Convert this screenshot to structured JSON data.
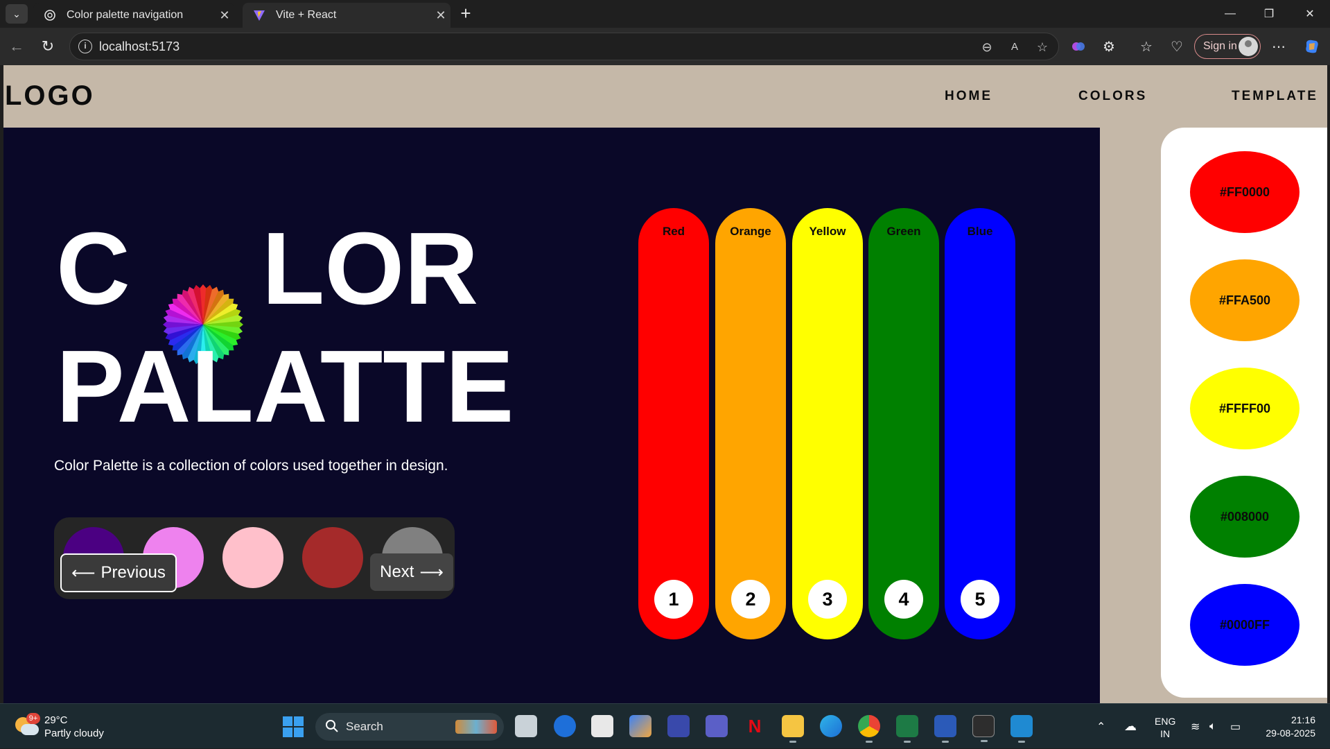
{
  "browser": {
    "tabs": [
      {
        "title": "Color palette navigation",
        "active": false
      },
      {
        "title": "Vite + React",
        "active": true
      }
    ],
    "url": "localhost:5173",
    "sign_in_label": "Sign in"
  },
  "site": {
    "logo": "LOGO",
    "nav": [
      "HOME",
      "COLORS",
      "TEMPLATE"
    ]
  },
  "hero": {
    "title_line1_left": "C",
    "title_line1_right": "LOR",
    "title_line2": "PALATTE",
    "description": "Color Palette is a collection of colors used together in design.",
    "swatches": [
      "#4b0082",
      "#ee82ee",
      "#ffc0cb",
      "#a52a2a",
      "#808080"
    ],
    "prev_label": "Previous",
    "next_label": "Next"
  },
  "color_bars": [
    {
      "label": "Red",
      "number": "1",
      "color": "#ff0000"
    },
    {
      "label": "Orange",
      "number": "2",
      "color": "#ffa500"
    },
    {
      "label": "Yellow",
      "number": "3",
      "color": "#ffff00"
    },
    {
      "label": "Green",
      "number": "4",
      "color": "#008000"
    },
    {
      "label": "Blue",
      "number": "5",
      "color": "#0000ff"
    }
  ],
  "hex_codes": [
    {
      "code": "#FF0000",
      "color": "#ff0000"
    },
    {
      "code": "#FFA500",
      "color": "#ffa500"
    },
    {
      "code": "#FFFF00",
      "color": "#ffff00"
    },
    {
      "code": "#008000",
      "color": "#008000"
    },
    {
      "code": "#0000FF",
      "color": "#0000ff"
    }
  ],
  "taskbar": {
    "weather_temp": "29°C",
    "weather_desc": "Partly cloudy",
    "weather_badge": "9+",
    "search_placeholder": "Search",
    "lang_line1": "ENG",
    "lang_line2": "IN",
    "time": "21:16",
    "date": "29-08-2025"
  }
}
